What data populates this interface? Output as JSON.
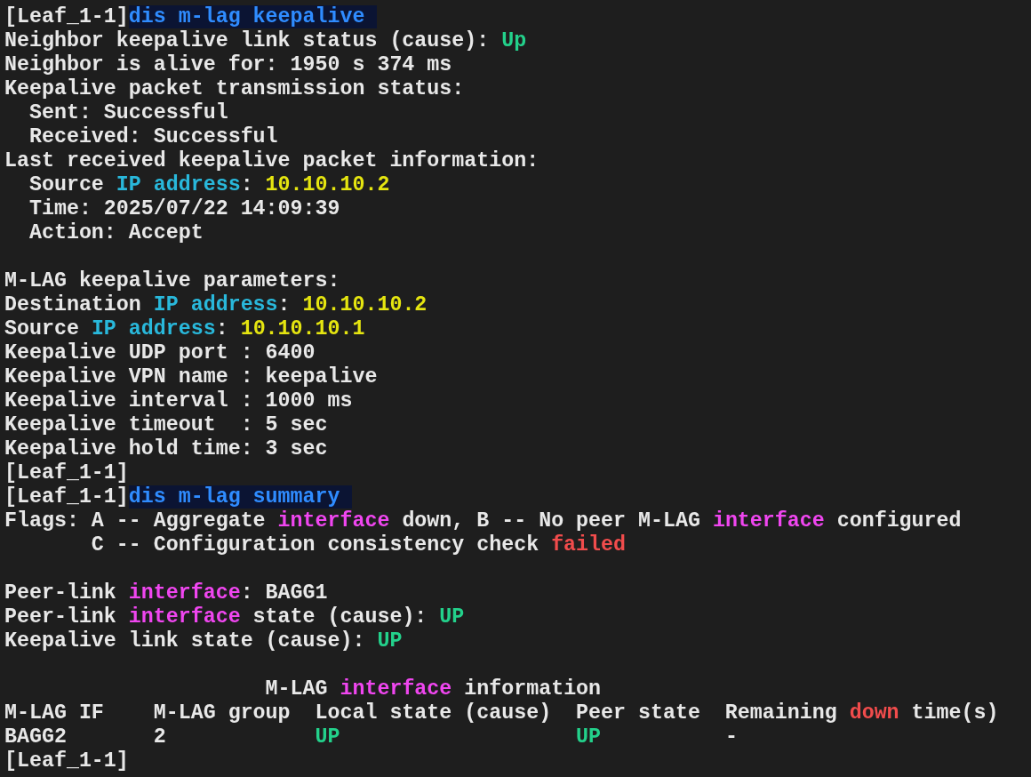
{
  "terminal": {
    "lines": [
      {
        "kind": "output",
        "segments": [
          {
            "kind": "text",
            "text": "[Leaf_1-1]",
            "color": "#e8e8e8"
          },
          {
            "kind": "command",
            "text": "dis m-lag keepalive ",
            "color": "#2f8cff"
          }
        ]
      },
      {
        "kind": "output",
        "segments": [
          {
            "kind": "text",
            "text": "Neighbor keepalive link status (cause): ",
            "color": "#e8e8e8"
          },
          {
            "kind": "text",
            "text": "Up",
            "color": "#23d18b"
          }
        ]
      },
      {
        "kind": "output",
        "segments": [
          {
            "kind": "text",
            "text": "Neighbor is alive for: 1950 s 374 ms",
            "color": "#e8e8e8"
          }
        ]
      },
      {
        "kind": "output",
        "segments": [
          {
            "kind": "text",
            "text": "Keepalive packet transmission status:",
            "color": "#e8e8e8"
          }
        ]
      },
      {
        "kind": "output",
        "segments": [
          {
            "kind": "text",
            "text": "  Sent: Successful",
            "color": "#e8e8e8"
          }
        ]
      },
      {
        "kind": "output",
        "segments": [
          {
            "kind": "text",
            "text": "  Received: Successful",
            "color": "#e8e8e8"
          }
        ]
      },
      {
        "kind": "output",
        "segments": [
          {
            "kind": "text",
            "text": "Last received keepalive packet information:",
            "color": "#e8e8e8"
          }
        ]
      },
      {
        "kind": "output",
        "segments": [
          {
            "kind": "text",
            "text": "  Source ",
            "color": "#e8e8e8"
          },
          {
            "kind": "text",
            "text": "IP address",
            "color": "#29b8db"
          },
          {
            "kind": "text",
            "text": ": ",
            "color": "#e8e8e8"
          },
          {
            "kind": "text",
            "text": "10.10.10.2",
            "color": "#e5e510"
          }
        ]
      },
      {
        "kind": "output",
        "segments": [
          {
            "kind": "text",
            "text": "  Time: 2025/07/22 14:09:39",
            "color": "#e8e8e8"
          }
        ]
      },
      {
        "kind": "output",
        "segments": [
          {
            "kind": "text",
            "text": "  Action: Accept",
            "color": "#e8e8e8"
          }
        ]
      },
      {
        "kind": "blank"
      },
      {
        "kind": "output",
        "segments": [
          {
            "kind": "text",
            "text": "M-LAG keepalive parameters:",
            "color": "#e8e8e8"
          }
        ]
      },
      {
        "kind": "output",
        "segments": [
          {
            "kind": "text",
            "text": "Destination ",
            "color": "#e8e8e8"
          },
          {
            "kind": "text",
            "text": "IP address",
            "color": "#29b8db"
          },
          {
            "kind": "text",
            "text": ": ",
            "color": "#e8e8e8"
          },
          {
            "kind": "text",
            "text": "10.10.10.2",
            "color": "#e5e510"
          }
        ]
      },
      {
        "kind": "output",
        "segments": [
          {
            "kind": "text",
            "text": "Source ",
            "color": "#e8e8e8"
          },
          {
            "kind": "text",
            "text": "IP address",
            "color": "#29b8db"
          },
          {
            "kind": "text",
            "text": ": ",
            "color": "#e8e8e8"
          },
          {
            "kind": "text",
            "text": "10.10.10.1",
            "color": "#e5e510"
          }
        ]
      },
      {
        "kind": "output",
        "segments": [
          {
            "kind": "text",
            "text": "Keepalive UDP port : 6400",
            "color": "#e8e8e8"
          }
        ]
      },
      {
        "kind": "output",
        "segments": [
          {
            "kind": "text",
            "text": "Keepalive VPN name : keepalive",
            "color": "#e8e8e8"
          }
        ]
      },
      {
        "kind": "output",
        "segments": [
          {
            "kind": "text",
            "text": "Keepalive interval : 1000 ms",
            "color": "#e8e8e8"
          }
        ]
      },
      {
        "kind": "output",
        "segments": [
          {
            "kind": "text",
            "text": "Keepalive timeout  : 5 sec",
            "color": "#e8e8e8"
          }
        ]
      },
      {
        "kind": "output",
        "segments": [
          {
            "kind": "text",
            "text": "Keepalive hold time: 3 sec",
            "color": "#e8e8e8"
          }
        ]
      },
      {
        "kind": "output",
        "segments": [
          {
            "kind": "text",
            "text": "[Leaf_1-1]",
            "color": "#e8e8e8"
          }
        ]
      },
      {
        "kind": "output",
        "segments": [
          {
            "kind": "text",
            "text": "[Leaf_1-1]",
            "color": "#e8e8e8"
          },
          {
            "kind": "command",
            "text": "dis m-lag summary ",
            "color": "#2f8cff"
          }
        ]
      },
      {
        "kind": "output",
        "segments": [
          {
            "kind": "text",
            "text": "Flags: A -- Aggregate ",
            "color": "#e8e8e8"
          },
          {
            "kind": "text",
            "text": "interface",
            "color": "#f046f0"
          },
          {
            "kind": "text",
            "text": " down, B -- No peer M-LAG ",
            "color": "#e8e8e8"
          },
          {
            "kind": "text",
            "text": "interface",
            "color": "#f046f0"
          },
          {
            "kind": "text",
            "text": " configured",
            "color": "#e8e8e8"
          }
        ]
      },
      {
        "kind": "output",
        "segments": [
          {
            "kind": "text",
            "text": "       C -- Configuration consistency check ",
            "color": "#e8e8e8"
          },
          {
            "kind": "text",
            "text": "failed",
            "color": "#f14c4c"
          }
        ]
      },
      {
        "kind": "blank"
      },
      {
        "kind": "output",
        "segments": [
          {
            "kind": "text",
            "text": "Peer-link ",
            "color": "#e8e8e8"
          },
          {
            "kind": "text",
            "text": "interface",
            "color": "#f046f0"
          },
          {
            "kind": "text",
            "text": ": BAGG1",
            "color": "#e8e8e8"
          }
        ]
      },
      {
        "kind": "output",
        "segments": [
          {
            "kind": "text",
            "text": "Peer-link ",
            "color": "#e8e8e8"
          },
          {
            "kind": "text",
            "text": "interface",
            "color": "#f046f0"
          },
          {
            "kind": "text",
            "text": " state (cause): ",
            "color": "#e8e8e8"
          },
          {
            "kind": "text",
            "text": "UP",
            "color": "#23d18b"
          }
        ]
      },
      {
        "kind": "output",
        "segments": [
          {
            "kind": "text",
            "text": "Keepalive link state (cause): ",
            "color": "#e8e8e8"
          },
          {
            "kind": "text",
            "text": "UP",
            "color": "#23d18b"
          }
        ]
      },
      {
        "kind": "blank"
      },
      {
        "kind": "output",
        "segments": [
          {
            "kind": "text",
            "text": "                     M-LAG ",
            "color": "#e8e8e8"
          },
          {
            "kind": "text",
            "text": "interface",
            "color": "#f046f0"
          },
          {
            "kind": "text",
            "text": " information",
            "color": "#e8e8e8"
          }
        ]
      },
      {
        "kind": "output",
        "segments": [
          {
            "kind": "text",
            "text": "M-LAG IF    M-LAG group  Local state (cause)  Peer state  Remaining ",
            "color": "#e8e8e8"
          },
          {
            "kind": "text",
            "text": "down",
            "color": "#f14c4c"
          },
          {
            "kind": "text",
            "text": " time(s)",
            "color": "#e8e8e8"
          }
        ]
      },
      {
        "kind": "output",
        "segments": [
          {
            "kind": "text",
            "text": "BAGG2       2            ",
            "color": "#e8e8e8"
          },
          {
            "kind": "text",
            "text": "UP                   ",
            "color": "#23d18b"
          },
          {
            "kind": "text",
            "text": "UP",
            "color": "#23d18b"
          },
          {
            "kind": "text",
            "text": "          -",
            "color": "#e8e8e8"
          }
        ]
      },
      {
        "kind": "output",
        "segments": [
          {
            "kind": "text",
            "text": "[Leaf_1-1]",
            "color": "#e8e8e8"
          }
        ]
      }
    ]
  }
}
